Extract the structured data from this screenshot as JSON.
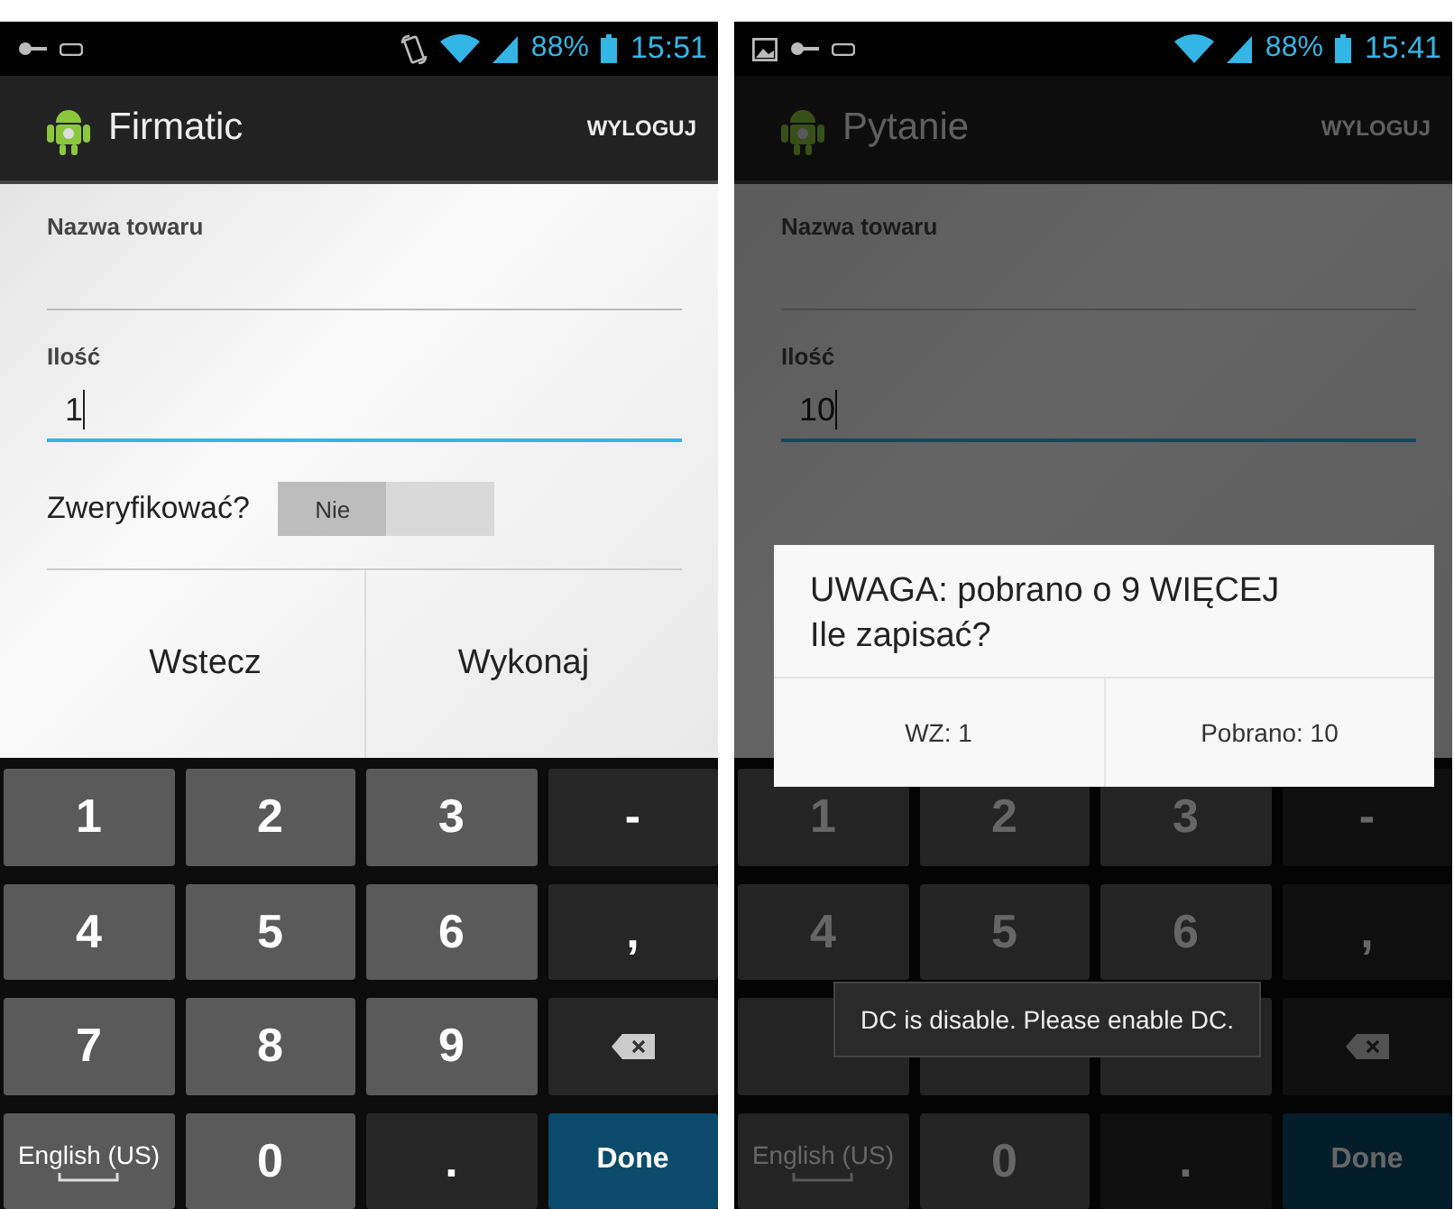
{
  "screens": [
    {
      "status_bar": {
        "left_icons": [
          {
            "kind": "key"
          },
          {
            "kind": "usb"
          }
        ],
        "right_icons": [
          {
            "kind": "rotate"
          },
          {
            "kind": "wifi"
          },
          {
            "kind": "signal"
          }
        ],
        "battery": "88%",
        "time": "15:51"
      },
      "action_bar": {
        "title": "Firmatic",
        "action": "WYLOGUJ"
      },
      "dimmed": false,
      "fields": [
        {
          "label": "Nazwa towaru",
          "focused": false
        },
        {
          "label": "Ilość",
          "value": "1",
          "focused": true
        }
      ],
      "toggle": {
        "label": "Zweryfikować?",
        "state_text": "Nie",
        "on": false
      },
      "buttons": [
        "Wstecz",
        "Wykonaj"
      ],
      "keyboard": [
        {
          "kind": "digit",
          "label": "1"
        },
        {
          "kind": "digit",
          "label": "2"
        },
        {
          "kind": "digit",
          "label": "3"
        },
        {
          "kind": "symbol",
          "label": "-"
        },
        {
          "kind": "digit",
          "label": "4"
        },
        {
          "kind": "digit",
          "label": "5"
        },
        {
          "kind": "digit",
          "label": "6"
        },
        {
          "kind": "symbol",
          "label": ","
        },
        {
          "kind": "digit",
          "label": "7"
        },
        {
          "kind": "digit",
          "label": "8"
        },
        {
          "kind": "digit",
          "label": "9"
        },
        {
          "kind": "backspace"
        },
        {
          "kind": "language",
          "label": "English (US)"
        },
        {
          "kind": "digit",
          "label": "0"
        },
        {
          "kind": "symbol",
          "label": "."
        },
        {
          "kind": "done",
          "label": "Done"
        }
      ]
    },
    {
      "status_bar": {
        "left_icons": [
          {
            "kind": "image"
          },
          {
            "kind": "key"
          },
          {
            "kind": "usb"
          }
        ],
        "right_icons": [
          {
            "kind": "wifi"
          },
          {
            "kind": "signal"
          }
        ],
        "battery": "88%",
        "time": "15:41"
      },
      "action_bar": {
        "title": "Pytanie",
        "action": "WYLOGUJ"
      },
      "dimmed": true,
      "fields": [
        {
          "label": "Nazwa towaru",
          "focused": false
        },
        {
          "label": "Ilość",
          "value": "10",
          "focused": true
        }
      ],
      "dialog": {
        "message": "UWAGA: pobrano o 9 WIĘCEJ\nIle zapisać?",
        "buttons": [
          "WZ: 1",
          "Pobrano: 10"
        ]
      },
      "toast": "DC is disable. Please enable DC.",
      "keyboard": [
        {
          "kind": "digit",
          "label": "1"
        },
        {
          "kind": "digit",
          "label": "2"
        },
        {
          "kind": "digit",
          "label": "3"
        },
        {
          "kind": "symbol",
          "label": "-"
        },
        {
          "kind": "digit",
          "label": "4"
        },
        {
          "kind": "digit",
          "label": "5"
        },
        {
          "kind": "digit",
          "label": "6"
        },
        {
          "kind": "symbol",
          "label": ","
        },
        {
          "kind": "digit"
        },
        {
          "kind": "digit"
        },
        {
          "kind": "digit"
        },
        {
          "kind": "backspace"
        },
        {
          "kind": "language",
          "label": "English (US)"
        },
        {
          "kind": "digit",
          "label": "0"
        },
        {
          "kind": "symbol",
          "label": "."
        },
        {
          "kind": "done",
          "label": "Done"
        }
      ]
    }
  ]
}
